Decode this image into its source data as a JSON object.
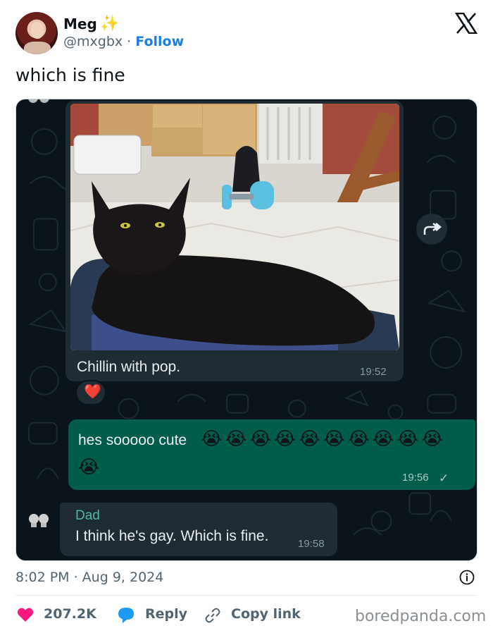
{
  "author": {
    "name": "Meg",
    "name_emoji": "✨",
    "handle": "@mxgbx",
    "separator": "·",
    "follow_label": "Follow"
  },
  "tweet": {
    "text": "which is fine",
    "timestamp": "8:02 PM · Aug 9, 2024"
  },
  "chat": {
    "image_message": {
      "caption": "Chillin with pop.",
      "time": "19:52",
      "reaction": "❤️"
    },
    "outgoing_message": {
      "text": "hes sooooo cute",
      "emoji": [
        "😭",
        "😭",
        "😭",
        "😭",
        "😭",
        "😭",
        "😭",
        "😭",
        "😭",
        "😭",
        "😭"
      ],
      "time": "19:56",
      "status": "✓"
    },
    "incoming_message": {
      "sender": "Dad",
      "text": "I think he's gay. Which is fine.",
      "time": "19:58"
    }
  },
  "footer": {
    "likes": "207.2K",
    "reply_label": "Reply",
    "copy_link_label": "Copy link",
    "watermark": "boredpanda.com"
  },
  "colors": {
    "like": "#f91880",
    "reply": "#1d9bf0",
    "follow": "#1d7fe0",
    "chat_bg": "#0b141a",
    "outgoing_bubble": "#005c4b",
    "incoming_bubble": "#1f2c34"
  },
  "icons": [
    "sparkle-icon",
    "x-logo-icon",
    "forward-icon",
    "heart-reaction-icon",
    "check-icon",
    "info-icon",
    "heart-icon",
    "reply-bubble-icon",
    "link-icon"
  ]
}
